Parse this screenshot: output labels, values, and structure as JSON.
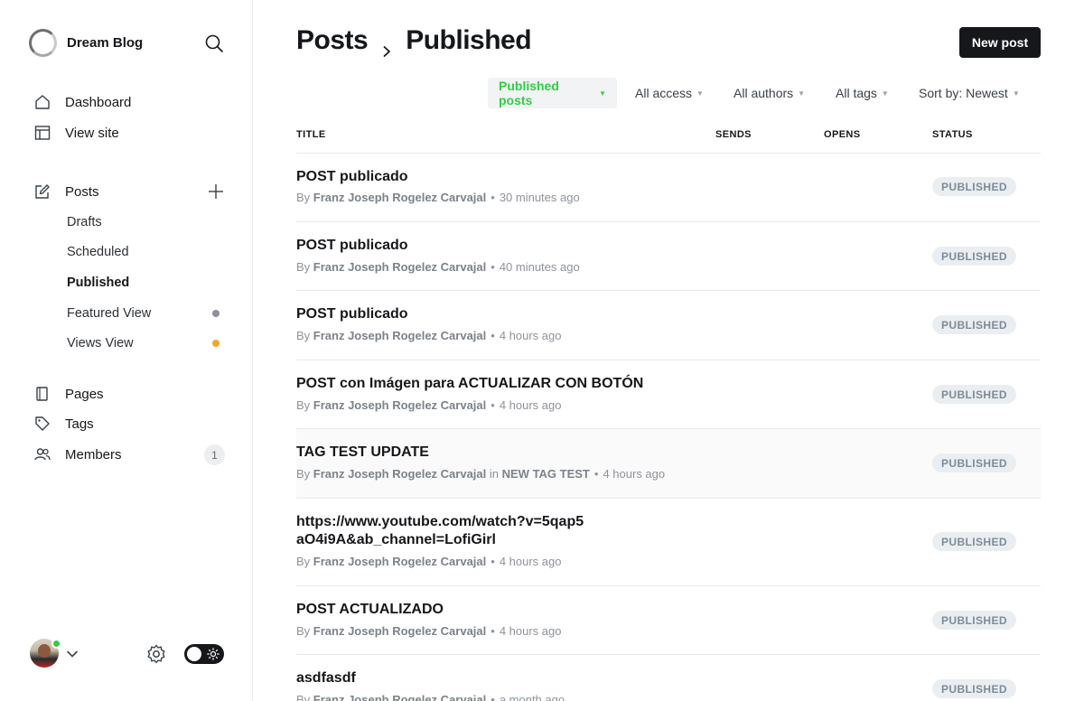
{
  "brand": {
    "name": "Dream Blog"
  },
  "sidebar": {
    "nav": [
      {
        "label": "Dashboard",
        "icon": "home-icon"
      },
      {
        "label": "View site",
        "icon": "layout-icon"
      }
    ],
    "posts": {
      "label": "Posts",
      "sub": [
        {
          "label": "Drafts"
        },
        {
          "label": "Scheduled"
        },
        {
          "label": "Published"
        },
        {
          "label": "Featured View",
          "dot_color": "#8e8fa0"
        },
        {
          "label": "Views View",
          "dot_color": "#f5a623"
        }
      ]
    },
    "bottom_nav": [
      {
        "label": "Pages",
        "icon": "page-icon"
      },
      {
        "label": "Tags",
        "icon": "tag-icon"
      },
      {
        "label": "Members",
        "icon": "members-icon",
        "count": "1"
      }
    ]
  },
  "header": {
    "breadcrumb_root": "Posts",
    "breadcrumb_current": "Published",
    "new_post_label": "New post"
  },
  "filters": {
    "type": "Published posts",
    "access": "All access",
    "authors": "All authors",
    "tags": "All tags",
    "sort": "Sort by: Newest"
  },
  "table": {
    "columns": {
      "title": "TITLE",
      "sends": "SENDS",
      "opens": "OPENS",
      "status": "STATUS"
    },
    "rows": [
      {
        "title": "POST publicado",
        "by": "By",
        "author": "Franz Joseph Rogelez Carvajal",
        "time": "30 minutes ago",
        "status": "PUBLISHED"
      },
      {
        "title": "POST publicado",
        "by": "By",
        "author": "Franz Joseph Rogelez Carvajal",
        "time": "40 minutes ago",
        "status": "PUBLISHED"
      },
      {
        "title": "POST publicado",
        "by": "By",
        "author": "Franz Joseph Rogelez Carvajal",
        "time": "4 hours ago",
        "status": "PUBLISHED"
      },
      {
        "title": "POST con Imágen para ACTUALIZAR CON BOTÓN",
        "by": "By",
        "author": "Franz Joseph Rogelez Carvajal",
        "time": "4 hours ago",
        "status": "PUBLISHED"
      },
      {
        "title": "TAG TEST UPDATE",
        "by": "By",
        "author": "Franz Joseph Rogelez Carvajal",
        "in": "in",
        "tag": "NEW TAG TEST",
        "time": "4 hours ago",
        "status": "PUBLISHED"
      },
      {
        "title": "https://www.youtube.com/watch?v=5qap5aO4i9A&ab_channel=LofiGirl",
        "by": "By",
        "author": "Franz Joseph Rogelez Carvajal",
        "time": "4 hours ago",
        "status": "PUBLISHED"
      },
      {
        "title": "POST ACTUALIZADO",
        "by": "By",
        "author": "Franz Joseph Rogelez Carvajal",
        "time": "4 hours ago",
        "status": "PUBLISHED"
      },
      {
        "title": "asdfasdf",
        "by": "By",
        "author": "Franz Joseph Rogelez Carvajal",
        "time": "a month ago",
        "status": "PUBLISHED"
      }
    ]
  },
  "colors": {
    "accent": "#30cf43",
    "dark": "#15171a"
  }
}
